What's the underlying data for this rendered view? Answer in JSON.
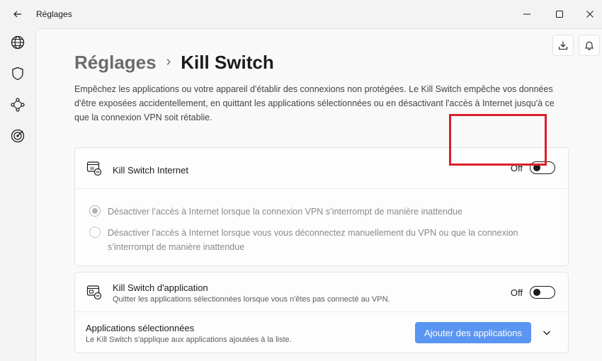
{
  "titlebar": {
    "title": "Réglages",
    "back_icon": "arrow-left-icon",
    "controls": [
      "minimize-icon",
      "maximize-icon",
      "close-icon"
    ]
  },
  "nav_rail": {
    "items": [
      {
        "icon": "globe-icon"
      },
      {
        "icon": "shield-icon"
      },
      {
        "icon": "meshnet-icon"
      },
      {
        "icon": "target-icon"
      }
    ]
  },
  "header_actions": {
    "download_icon": "download-icon",
    "notifications_icon": "bell-icon"
  },
  "breadcrumb": {
    "parent": "Réglages",
    "separator": "›",
    "current": "Kill Switch"
  },
  "description": "Empêchez les applications ou votre appareil d'établir des connexions non protégées. Le Kill Switch empêche vos données d'être exposées accidentellement, en quittant les applications sélectionnées ou en désactivant l'accès à Internet jusqu'à ce que la connexion VPN soit rétablie.",
  "internet_kill_switch": {
    "label": "Kill Switch Internet",
    "icon": "internet-kill-switch-icon",
    "state_label": "Off",
    "enabled": false,
    "options": [
      {
        "text": "Désactiver l’accès à Internet lorsque la connexion VPN s’interrompt de manière inattendue",
        "selected": true
      },
      {
        "text": "Désactiver l’accès à Internet lorsque vous vous déconnectez manuellement du VPN ou que la connexion s’interrompt de manière inattendue",
        "selected": false
      }
    ]
  },
  "app_kill_switch": {
    "label": "Kill Switch d'application",
    "sublabel": "Quitter les applications sélectionnées lorsque vous n'êtes pas connecté au VPN.",
    "icon": "app-kill-switch-icon",
    "state_label": "Off",
    "enabled": false,
    "selected_apps": {
      "label": "Applications sélectionnées",
      "sublabel": "Le Kill Switch s'applique aux applications ajoutées à la liste.",
      "add_button": "Ajouter des applications",
      "expand_icon": "chevron-down-icon"
    }
  },
  "colors": {
    "accent": "#5a95f2",
    "highlight": "#d9202a",
    "background": "#f3f3f3",
    "card": "#fdfdfd"
  }
}
